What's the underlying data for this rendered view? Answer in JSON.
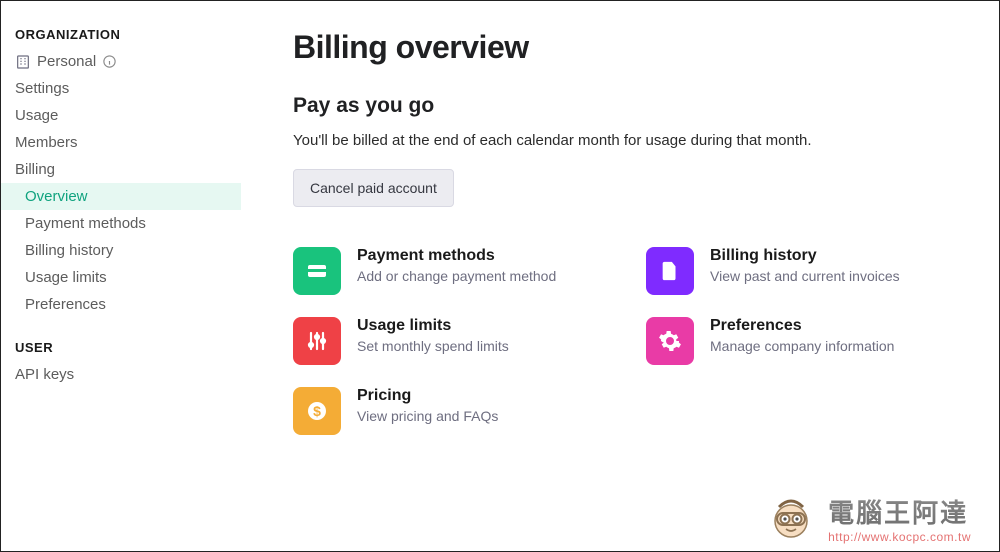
{
  "sidebar": {
    "section_org": "ORGANIZATION",
    "org_name": "Personal",
    "items": [
      "Settings",
      "Usage",
      "Members",
      "Billing"
    ],
    "billing_sub": [
      "Overview",
      "Payment methods",
      "Billing history",
      "Usage limits",
      "Preferences"
    ],
    "active_sub_index": 0,
    "section_user": "USER",
    "user_items": [
      "API keys"
    ]
  },
  "page": {
    "title": "Billing overview",
    "subtitle": "Pay as you go",
    "description": "You'll be billed at the end of each calendar month for usage during that month.",
    "cancel_button": "Cancel paid account"
  },
  "cards": [
    {
      "title": "Payment methods",
      "sub": "Add or change payment method",
      "icon": "credit-card",
      "color": "ic-green"
    },
    {
      "title": "Billing history",
      "sub": "View past and current invoices",
      "icon": "document",
      "color": "ic-purple"
    },
    {
      "title": "Usage limits",
      "sub": "Set monthly spend limits",
      "icon": "sliders",
      "color": "ic-red"
    },
    {
      "title": "Preferences",
      "sub": "Manage company information",
      "icon": "gear",
      "color": "ic-pink"
    },
    {
      "title": "Pricing",
      "sub": "View pricing and FAQs",
      "icon": "dollar",
      "color": "ic-orange"
    }
  ],
  "watermark": {
    "text": "電腦王阿達",
    "url": "http://www.kocpc.com.tw"
  }
}
